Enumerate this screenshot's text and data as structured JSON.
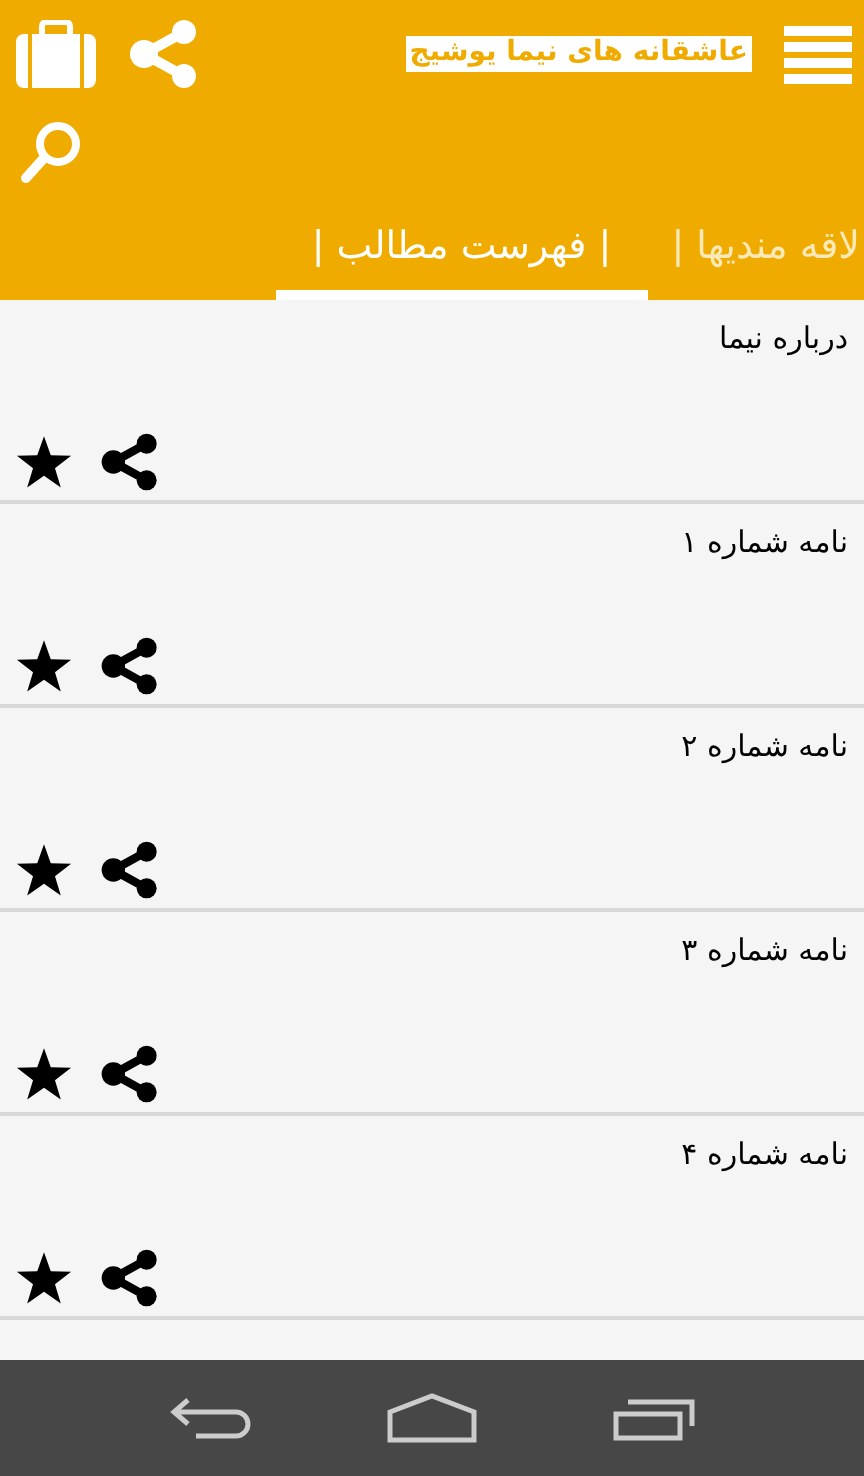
{
  "app_bar": {
    "title": "عاشقانه های نیما یوشیج"
  },
  "tabs": [
    {
      "label": "لاقه مندیها |",
      "selected": false
    },
    {
      "label": "| فهرست مطالب |",
      "selected": true
    }
  ],
  "items": [
    {
      "title": "درباره نیما"
    },
    {
      "title": "نامه شماره ۱"
    },
    {
      "title": "نامه شماره ۲"
    },
    {
      "title": "نامه شماره ۳"
    },
    {
      "title": "نامه شماره ۴"
    }
  ]
}
